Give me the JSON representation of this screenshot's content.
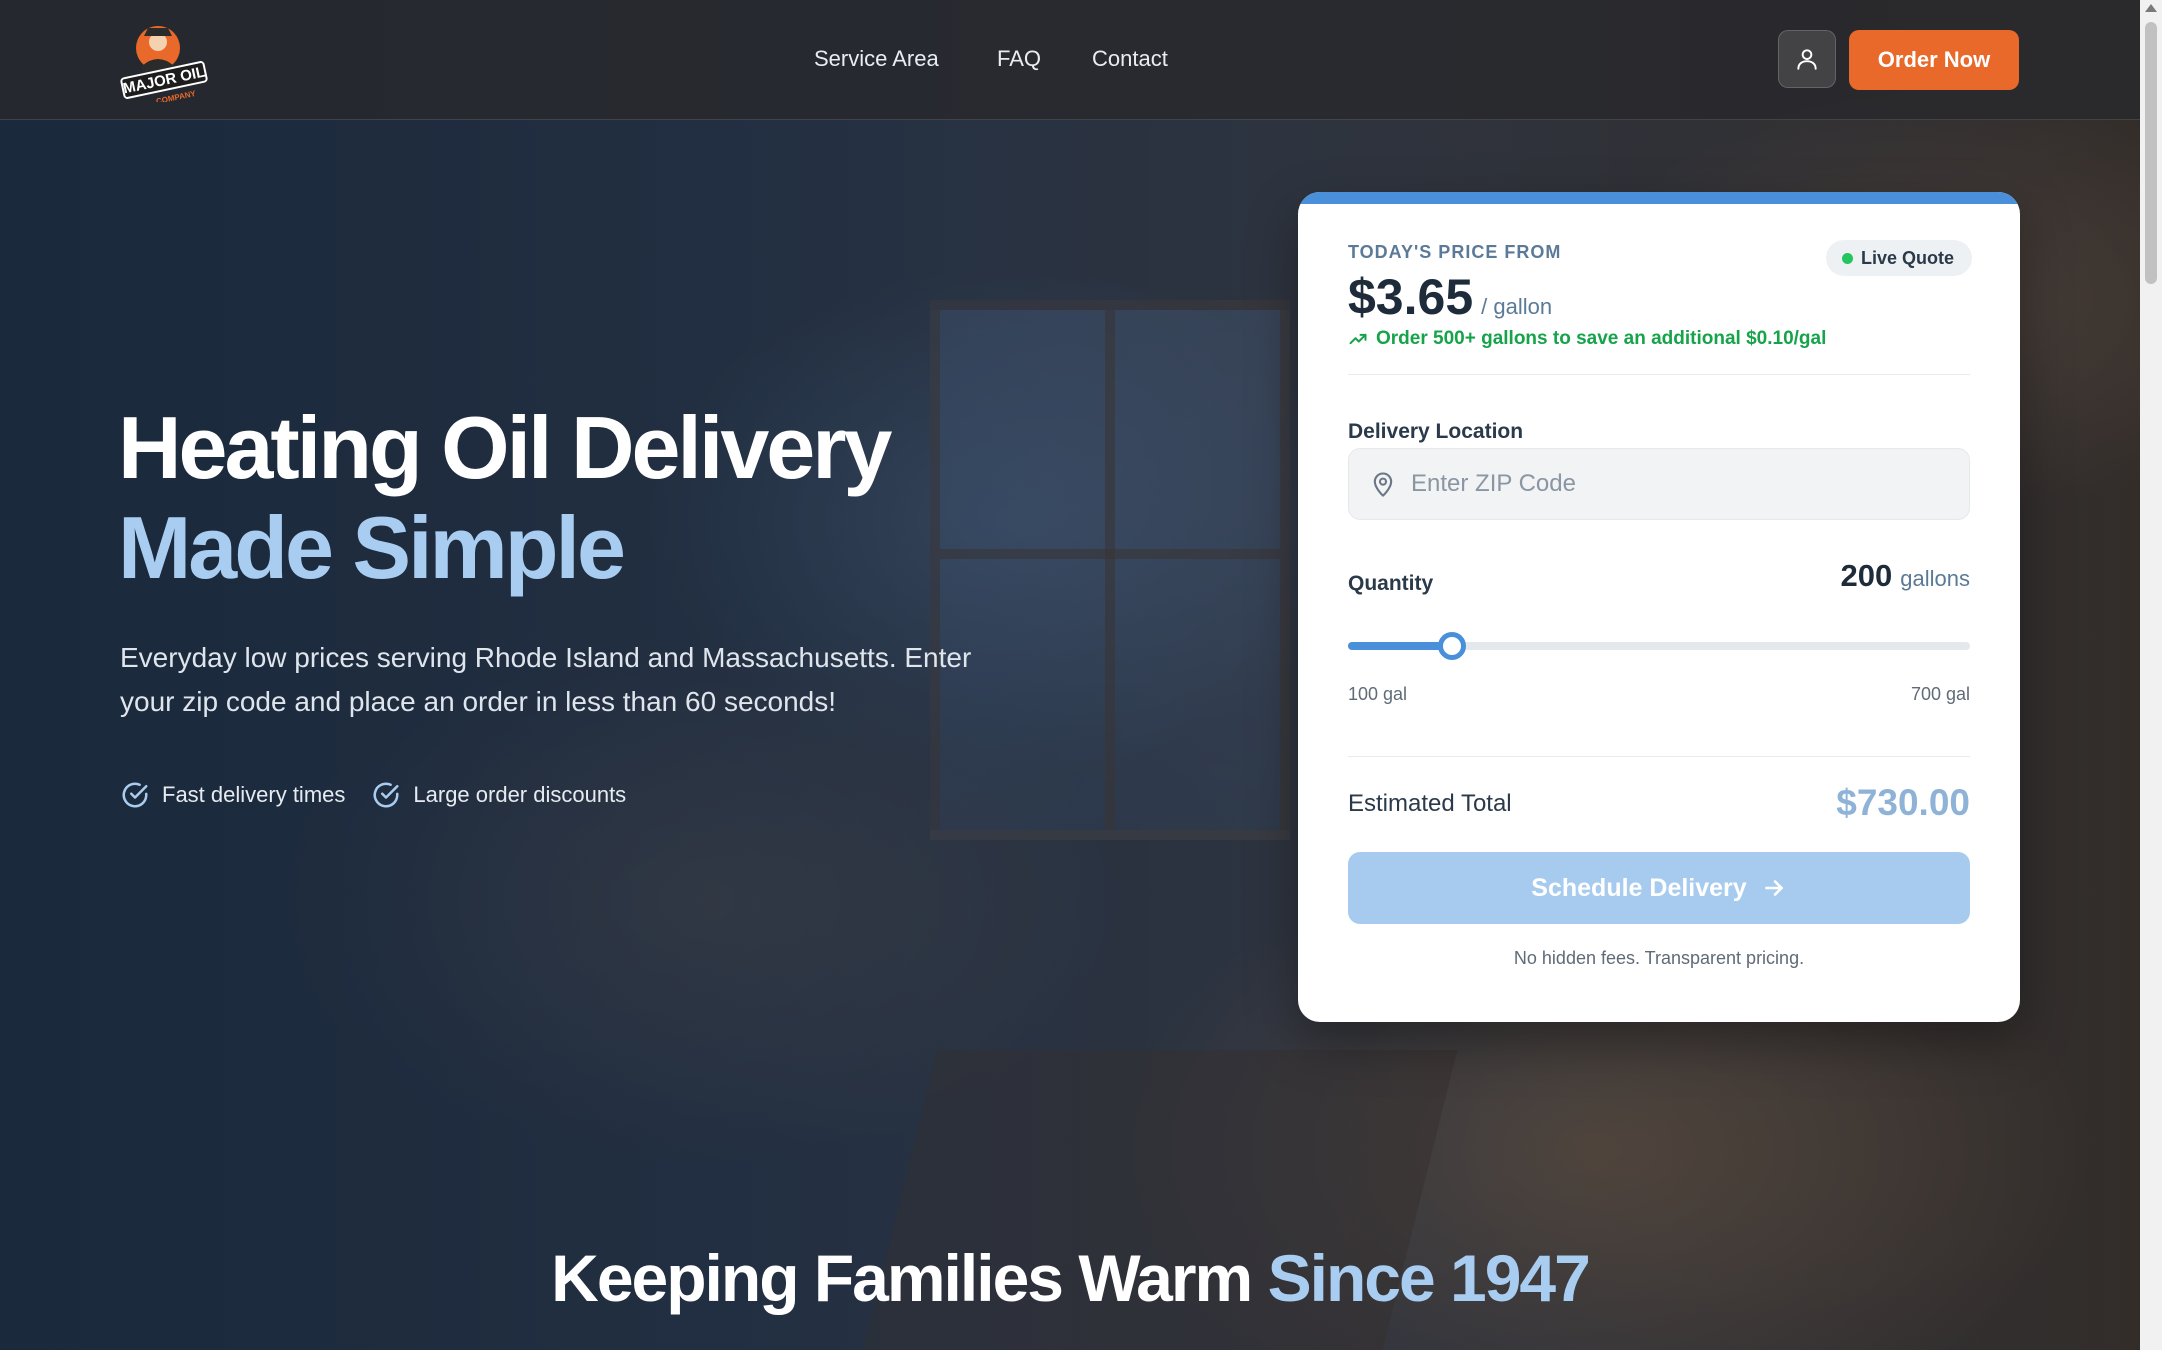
{
  "header": {
    "logo_text_line1": "MAJOR OIL",
    "logo_text_line2": "COMPANY",
    "nav": [
      {
        "label": "Service Area"
      },
      {
        "label": "FAQ"
      },
      {
        "label": "Contact"
      }
    ],
    "account_icon": "user-icon",
    "order_button": "Order Now",
    "order_button_color": "#e8692a"
  },
  "hero": {
    "headline_line1": "Heating Oil Delivery",
    "headline_line2_part1": "Made",
    "headline_line2_part2": "Simple",
    "subtitle": "Everyday low prices serving Rhode Island and Massachusetts. Enter your zip code and place an order in less than 60 seconds!",
    "features": [
      {
        "icon": "check-circle-icon",
        "label": "Fast delivery times"
      },
      {
        "icon": "check-circle-icon",
        "label": "Large order discounts"
      }
    ],
    "accent_color": "#a9cdf1"
  },
  "quote_card": {
    "price_label": "TODAY'S PRICE FROM",
    "live_badge": "Live Quote",
    "price": "$3.65",
    "price_unit": "/ gallon",
    "savings_note": "Order 500+ gallons to save an additional $0.10/gal",
    "location_label": "Delivery Location",
    "zip_placeholder": "Enter ZIP Code",
    "zip_value": "",
    "quantity_label": "Quantity",
    "quantity_value": "200",
    "quantity_unit": "gallons",
    "slider_min": 100,
    "slider_max": 700,
    "slider_value": 200,
    "slider_min_label": "100 gal",
    "slider_max_label": "700 gal",
    "total_label": "Estimated Total",
    "total_value": "$730.00",
    "schedule_button": "Schedule Delivery",
    "fine_print": "No hidden fees. Transparent pricing.",
    "brand_blue": "#4a8fd9"
  },
  "bottom": {
    "heading_part1": "Keeping Families Warm",
    "heading_part2": "Since 1947"
  }
}
